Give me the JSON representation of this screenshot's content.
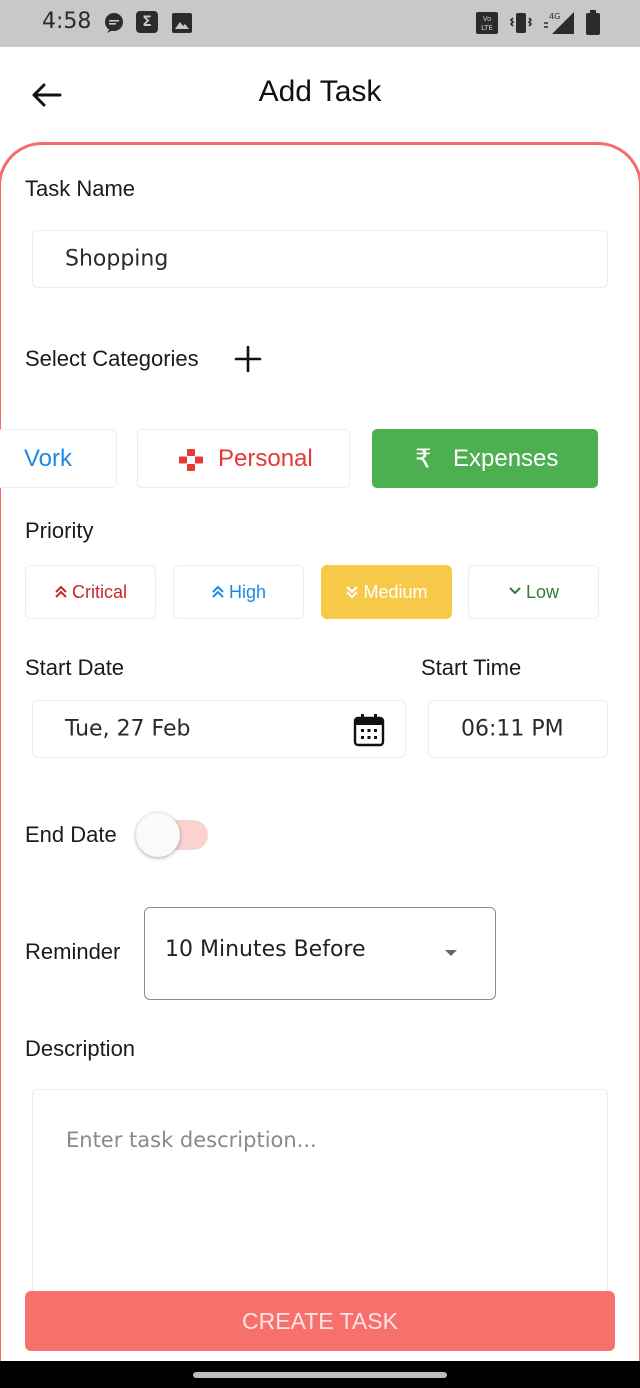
{
  "status_bar": {
    "time": "4:58",
    "left_icons": [
      "message-icon",
      "sigma-app-icon",
      "image-icon"
    ],
    "network": "4G",
    "volte": "Vo LTE",
    "right_icons": [
      "volte-icon",
      "vibrate-icon",
      "signal-icon",
      "battery-icon"
    ]
  },
  "header": {
    "title": "Add Task",
    "back_icon": "arrow-left-icon"
  },
  "form": {
    "task_name": {
      "label": "Task Name",
      "value": "Shopping"
    },
    "categories": {
      "label": "Select Categories",
      "add_icon": "plus-icon",
      "items": [
        {
          "label": "Vork",
          "icon": "",
          "color": "#1e88e5",
          "selected": false
        },
        {
          "label": "Personal",
          "icon": "gamepad-icon",
          "color": "#e53935",
          "selected": false
        },
        {
          "label": "Expenses",
          "icon": "rupee-icon",
          "color": "#ffffff",
          "bg": "#4caf50",
          "selected": true
        }
      ]
    },
    "priority": {
      "label": "Priority",
      "items": [
        {
          "label": "Critical",
          "icon": "double-chevron-up-icon",
          "color": "#c62828",
          "selected": false
        },
        {
          "label": "High",
          "icon": "double-chevron-up-icon",
          "color": "#1e88e5",
          "selected": false
        },
        {
          "label": "Medium",
          "icon": "double-chevron-down-icon",
          "color": "#ffffff",
          "bg": "#f7c948",
          "selected": true
        },
        {
          "label": "Low",
          "icon": "chevron-down-icon",
          "color": "#2e7d32",
          "selected": false
        }
      ]
    },
    "start_date": {
      "label": "Start Date",
      "value": "Tue, 27 Feb",
      "icon": "calendar-icon"
    },
    "start_time": {
      "label": "Start Time",
      "value": "06:11 PM"
    },
    "end_date": {
      "label": "End Date",
      "enabled": false
    },
    "reminder": {
      "label": "Reminder",
      "value": "10 Minutes Before"
    },
    "description": {
      "label": "Description",
      "placeholder": "Enter task description..."
    }
  },
  "actions": {
    "create_label": "CREATE TASK",
    "create_color": "#f7706c"
  },
  "theme": {
    "accent": "#f26d6b",
    "status_bar_bg": "#c8c8c8"
  }
}
